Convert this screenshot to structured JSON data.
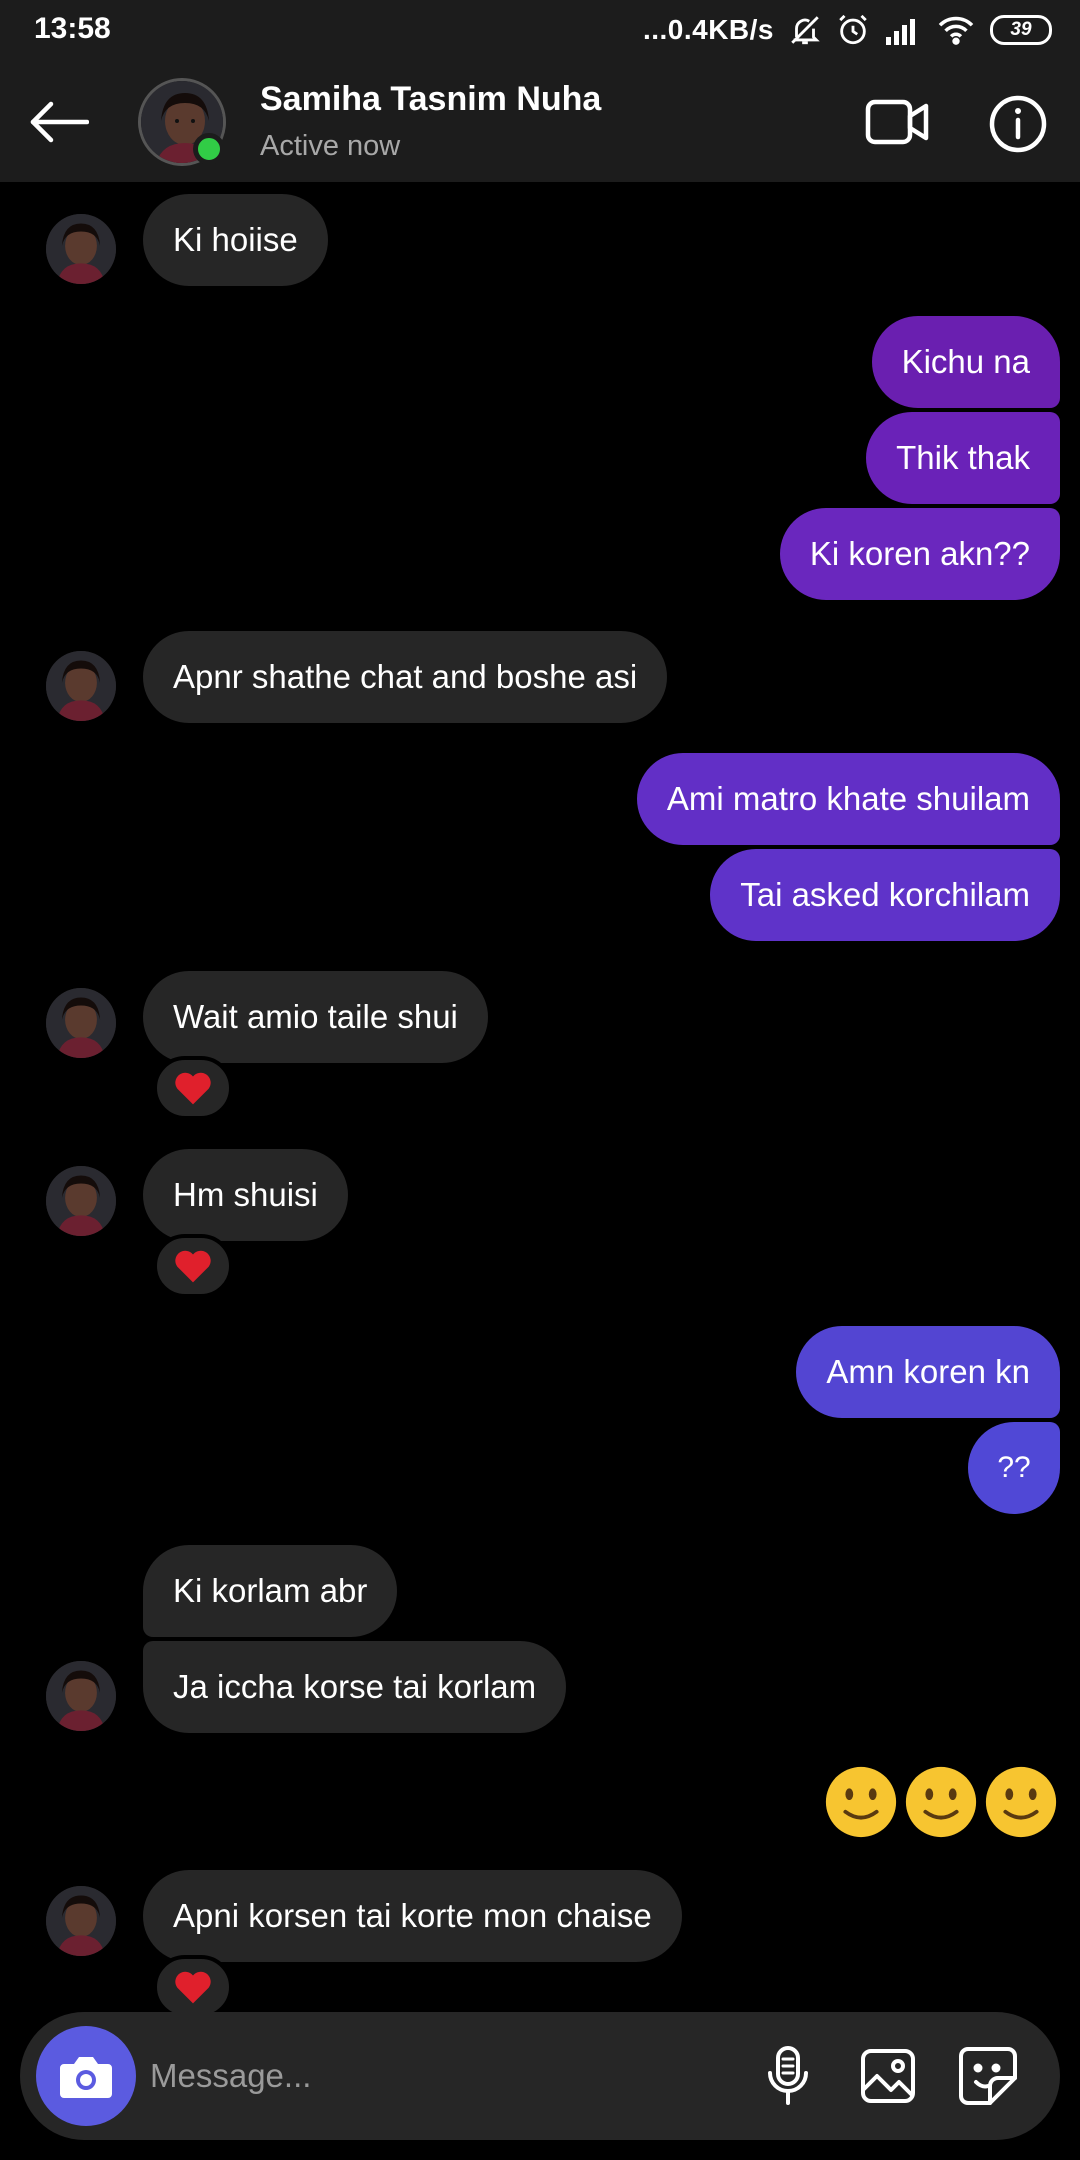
{
  "status_bar": {
    "time": "13:58",
    "speed": "...0.4KB/s",
    "battery": "39"
  },
  "header": {
    "contact_name": "Samiha Tasnim Nuha",
    "status": "Active now"
  },
  "messages": [
    {
      "from": "them",
      "text": "Ki hoiise"
    },
    {
      "from": "me",
      "text": "Kichu na"
    },
    {
      "from": "me",
      "text": "Thik thak"
    },
    {
      "from": "me",
      "text": "Ki koren akn??"
    },
    {
      "from": "them",
      "text": "Apnr shathe chat and boshe asi"
    },
    {
      "from": "me",
      "text": "Ami matro khate shuilam"
    },
    {
      "from": "me",
      "text": "Tai asked korchilam"
    },
    {
      "from": "them",
      "text": "Wait amio taile shui",
      "reaction": "heart"
    },
    {
      "from": "them",
      "text": "Hm shuisi",
      "reaction": "heart"
    },
    {
      "from": "me",
      "text": "Amn koren kn"
    },
    {
      "from": "me",
      "text": "??"
    },
    {
      "from": "them",
      "text": "Ki korlam abr"
    },
    {
      "from": "them",
      "text": "Ja iccha korse tai korlam"
    },
    {
      "from": "me",
      "text": "🙂🙂🙂",
      "emoji_only": true
    },
    {
      "from": "them",
      "text": "Apni korsen tai korte mon chaise",
      "reaction": "heart"
    }
  ],
  "composer": {
    "placeholder": "Message..."
  },
  "colors": {
    "outgoing_gradient": [
      "#6a1fb0",
      "#6a2dc4",
      "#5a3bd6",
      "#5048d6"
    ],
    "incoming": "#262626",
    "online": "#31cc46",
    "camera": "#5b5be0"
  },
  "icons": [
    "back-arrow-icon",
    "video-call-icon",
    "info-icon",
    "camera-icon",
    "microphone-icon",
    "image-icon",
    "sticker-icon",
    "heart-icon",
    "online-dot"
  ]
}
